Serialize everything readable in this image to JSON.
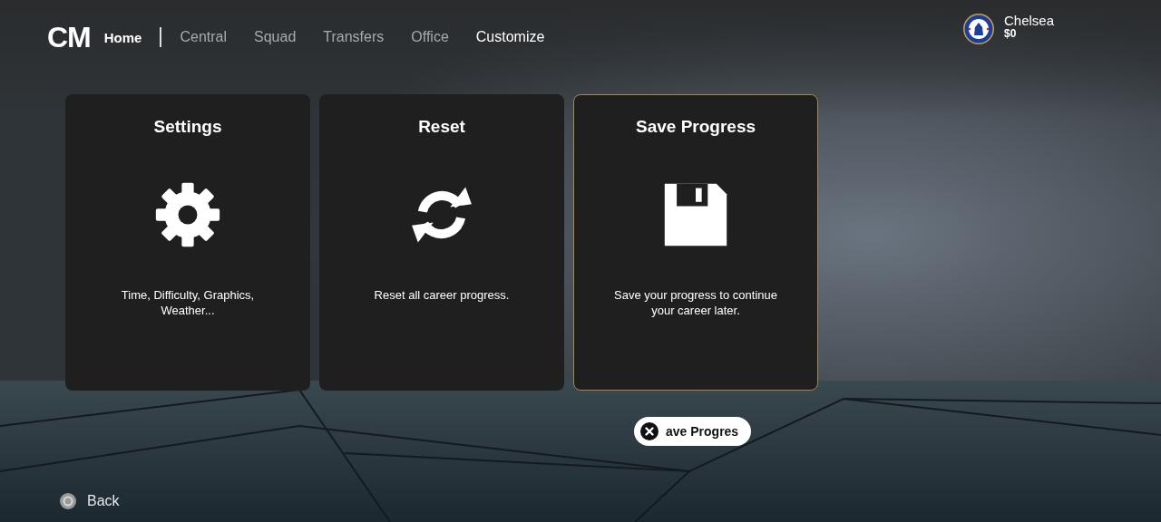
{
  "header": {
    "logo": "CM",
    "section": "Home",
    "tabs": [
      {
        "label": "Central",
        "selected": false
      },
      {
        "label": "Squad",
        "selected": false
      },
      {
        "label": "Transfers",
        "selected": false
      },
      {
        "label": "Office",
        "selected": false
      },
      {
        "label": "Customize",
        "selected": true
      }
    ]
  },
  "club": {
    "name": "Chelsea",
    "balance": "$0"
  },
  "cards": [
    {
      "kind": "settings",
      "title": "Settings",
      "description": "Time, Difficulty, Graphics, Weather...",
      "selected": false
    },
    {
      "kind": "reset",
      "title": "Reset",
      "description": "Reset all career progress.",
      "selected": false
    },
    {
      "kind": "save",
      "title": "Save Progress",
      "description": "Save your progress to continue your career later.",
      "selected": true
    }
  ],
  "prompt": {
    "label": "ave Progres"
  },
  "footer": {
    "back": "Back"
  }
}
